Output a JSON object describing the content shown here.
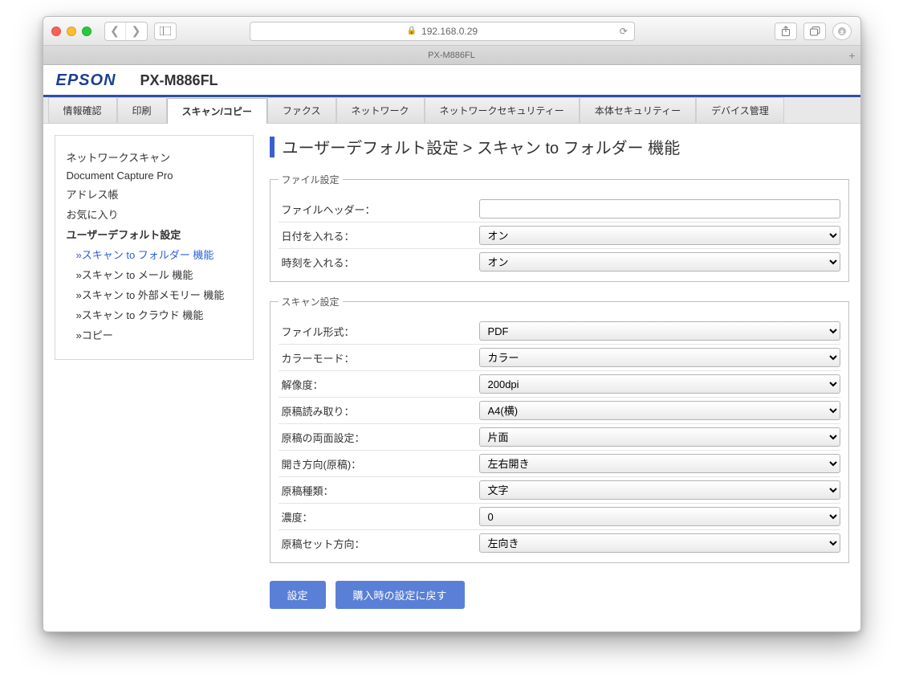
{
  "browser": {
    "address": "192.168.0.29",
    "tab_title": "PX-M886FL"
  },
  "header": {
    "brand": "EPSON",
    "model": "PX-M886FL"
  },
  "tabs": [
    {
      "label": "情報確認"
    },
    {
      "label": "印刷"
    },
    {
      "label": "スキャン/コピー",
      "active": true
    },
    {
      "label": "ファクス"
    },
    {
      "label": "ネットワーク"
    },
    {
      "label": "ネットワークセキュリティー"
    },
    {
      "label": "本体セキュリティー"
    },
    {
      "label": "デバイス管理"
    }
  ],
  "sidebar": {
    "items": [
      {
        "label": "ネットワークスキャン"
      },
      {
        "label": "Document Capture Pro"
      },
      {
        "label": "アドレス帳"
      },
      {
        "label": "お気に入り"
      },
      {
        "label": "ユーザーデフォルト設定",
        "bold": true,
        "children": [
          {
            "label": "»スキャン to フォルダー 機能",
            "active": true
          },
          {
            "label": "»スキャン to メール 機能"
          },
          {
            "label": "»スキャン to 外部メモリー 機能"
          },
          {
            "label": "»スキャン to クラウド 機能"
          },
          {
            "label": "»コピー"
          }
        ]
      }
    ]
  },
  "page_title": "ユーザーデフォルト設定 > スキャン to フォルダー 機能",
  "groups": {
    "file": {
      "legend": "ファイル設定",
      "fields": {
        "header": {
          "label": "ファイルヘッダー：",
          "value": ""
        },
        "include_date": {
          "label": "日付を入れる：",
          "value": "オン"
        },
        "include_time": {
          "label": "時刻を入れる：",
          "value": "オン"
        }
      }
    },
    "scan": {
      "legend": "スキャン設定",
      "fields": {
        "format": {
          "label": "ファイル形式：",
          "value": "PDF"
        },
        "color": {
          "label": "カラーモード：",
          "value": "カラー"
        },
        "resolution": {
          "label": "解像度：",
          "value": "200dpi"
        },
        "read_size": {
          "label": "原稿読み取り：",
          "value": "A4(横)"
        },
        "duplex": {
          "label": "原稿の両面設定：",
          "value": "片面"
        },
        "binding": {
          "label": "開き方向(原稿)：",
          "value": "左右開き"
        },
        "doc_type": {
          "label": "原稿種類：",
          "value": "文字"
        },
        "density": {
          "label": "濃度：",
          "value": "0"
        },
        "orientation": {
          "label": "原稿セット方向：",
          "value": "左向き"
        }
      }
    }
  },
  "buttons": {
    "apply": "設定",
    "reset": "購入時の設定に戻す"
  }
}
